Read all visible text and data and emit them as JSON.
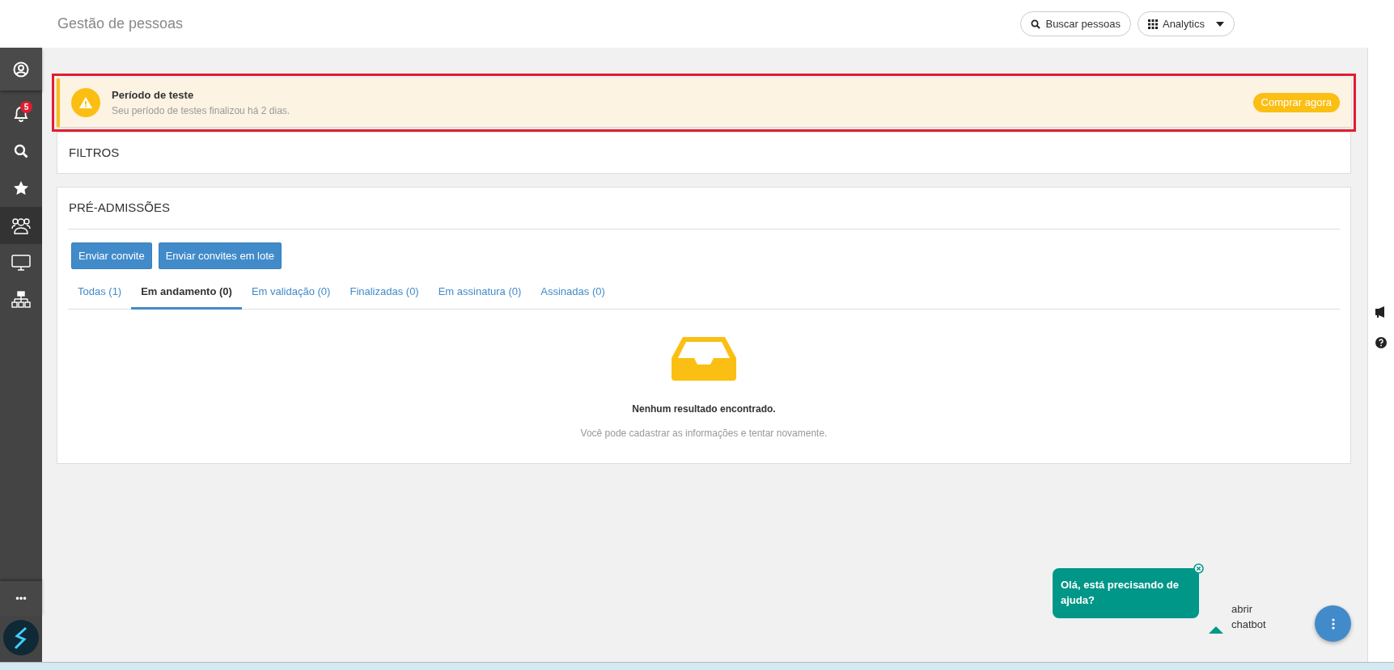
{
  "header": {
    "title": "Gestão de pessoas",
    "search_button": "Buscar pessoas",
    "analytics_button": "Analytics"
  },
  "sidebar": {
    "items": [
      {
        "kind": "profile",
        "selected": false
      },
      {
        "kind": "bell",
        "badge": "5",
        "selected": false
      },
      {
        "kind": "search",
        "selected": false
      },
      {
        "kind": "star",
        "selected": false
      },
      {
        "kind": "people",
        "selected": true
      },
      {
        "kind": "monitor",
        "selected": false
      },
      {
        "kind": "org",
        "selected": false
      }
    ],
    "more": "•••"
  },
  "alert": {
    "title": "Período de teste",
    "message": "Seu período de testes finalizou há 2 dias.",
    "action": "Comprar agora",
    "highlighted": true
  },
  "filters": {
    "title": "FILTROS"
  },
  "admissions": {
    "title": "PRÉ-ADMISSÕES",
    "buttons": [
      "Enviar convite",
      "Enviar convites em lote"
    ],
    "tabs": [
      {
        "label": "Todas (1)",
        "selected": false
      },
      {
        "label": "Em andamento (0)",
        "selected": true
      },
      {
        "label": "Em validação (0)",
        "selected": false
      },
      {
        "label": "Finalizadas (0)",
        "selected": false
      },
      {
        "label": "Em assinatura (0)",
        "selected": false
      },
      {
        "label": "Assinadas (0)",
        "selected": false
      }
    ],
    "empty": {
      "title": "Nenhum resultado encontrado.",
      "message": "Você pode cadastrar as informações e tentar novamente."
    }
  },
  "chat": {
    "bubble": "Olá, está precisando de ajuda?",
    "label": "abrir chatbot"
  }
}
